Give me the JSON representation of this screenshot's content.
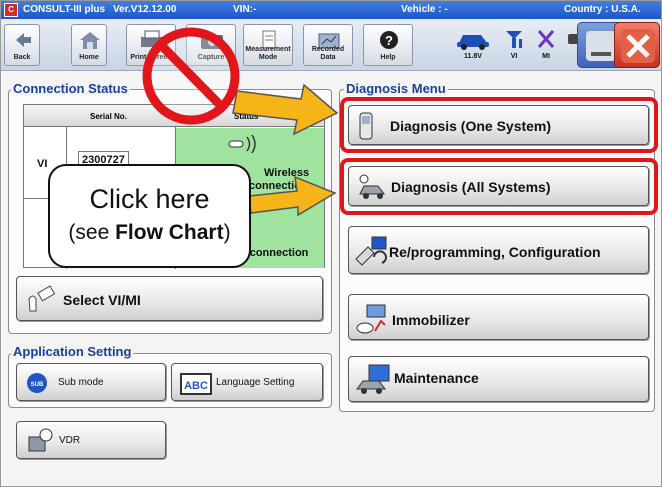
{
  "titlebar": {
    "app_name": "CONSULT-III plus",
    "version": "Ver.V12.12.00",
    "vin": "VIN:-",
    "vehicle": "Vehicle : -",
    "country": "Country : U.S.A."
  },
  "toolbar": {
    "back": "Back",
    "home": "Home",
    "print_screen": "Print Screen",
    "capture": "Capture",
    "measurement_mode_line1": "Measurement",
    "measurement_mode_line2": "Mode",
    "recorded_data_line1": "Recorded",
    "recorded_data_line2": "Data",
    "help": "Help",
    "battery_voltage": "11.8V",
    "vi_label": "VI",
    "mi_label": "MI"
  },
  "connection_status": {
    "title": "Connection Status",
    "col_serial": "Serial No.",
    "col_status": "Status",
    "row_vi_label": "VI",
    "row_vi_serial": "2300727",
    "row_vi_status_line1": "Wireless",
    "row_vi_status_line2": "connection",
    "row_mi_status": "No connection"
  },
  "select_vimi": {
    "label": "Select VI/MI"
  },
  "application_setting": {
    "title": "Application Setting",
    "sub_mode": "Sub mode",
    "language_setting": "Language Setting",
    "sub_badge": "SUB",
    "abc_badge": "ABC"
  },
  "vdr": {
    "label": "VDR"
  },
  "diagnosis_menu": {
    "title": "Diagnosis Menu",
    "one_system": "Diagnosis (One System)",
    "all_systems": "Diagnosis (All Systems)",
    "reprogramming": "Re/programming, Configuration",
    "immobilizer": "Immobilizer",
    "maintenance": "Maintenance"
  },
  "callout": {
    "line1": "Click here",
    "line2_prefix": "(see ",
    "line2_bold": "Flow Chart",
    "line2_suffix": ")"
  },
  "colors": {
    "highlight": "#e0161a",
    "arrow": "#f5b418",
    "title_blue": "#1b3f9c",
    "connected_green": "#9fe39f"
  }
}
